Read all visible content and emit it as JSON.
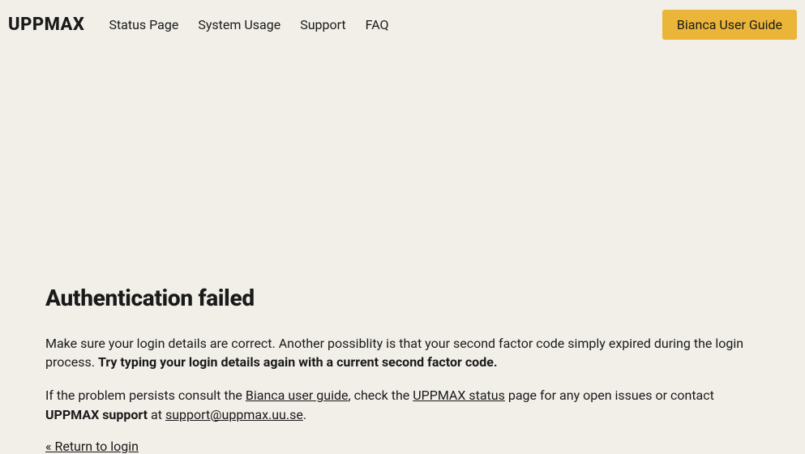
{
  "header": {
    "logo": "UPPMAX",
    "nav": [
      "Status Page",
      "System Usage",
      "Support",
      "FAQ"
    ],
    "cta": "Bianca User Guide"
  },
  "main": {
    "title": "Authentication failed",
    "p1_part1": "Make sure your login details are correct. Another possiblity is that your second factor code simply expired during the login process. ",
    "p1_bold": "Try typing your login details again with a current second factor code.",
    "p2_part1": "If the problem persists consult the ",
    "p2_link1": "Bianca user guide",
    "p2_part2": ", check the ",
    "p2_link2": "UPPMAX status",
    "p2_part3": " page for any open issues or contact ",
    "p2_bold": "UPPMAX support",
    "p2_part4": " at ",
    "p2_link3": "support@uppmax.uu.se",
    "p2_part5": ".",
    "return_link": "« Return to login"
  }
}
